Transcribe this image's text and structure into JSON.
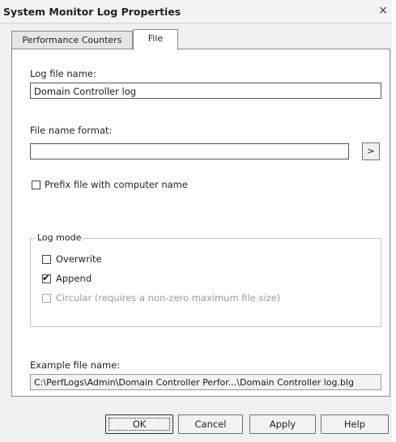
{
  "window": {
    "title": "System Monitor Log Properties",
    "close_label": "×"
  },
  "tabs": [
    {
      "label": "Performance Counters",
      "active": false
    },
    {
      "label": "File",
      "active": true
    }
  ],
  "file_tab": {
    "log_file_name_label": "Log file name:",
    "log_file_name_value": "Domain Controller log",
    "file_name_format_label": "File name format:",
    "file_name_format_value": "",
    "browse_label": ">",
    "prefix_label": "Prefix file with computer name",
    "prefix_checked": false,
    "log_mode": {
      "legend": "Log mode",
      "options": [
        {
          "label": "Overwrite",
          "checked": false,
          "enabled": true
        },
        {
          "label": "Append",
          "checked": true,
          "enabled": true
        },
        {
          "label": "Circular (requires a non-zero maximum file size)",
          "checked": false,
          "enabled": false
        }
      ]
    },
    "example_label": "Example file name:",
    "example_value": "C:\\PerfLogs\\Admin\\Domain Controller Perfor...\\Domain Controller log.blg"
  },
  "buttons": {
    "ok": "OK",
    "cancel": "Cancel",
    "apply": "Apply",
    "help": "Help"
  }
}
